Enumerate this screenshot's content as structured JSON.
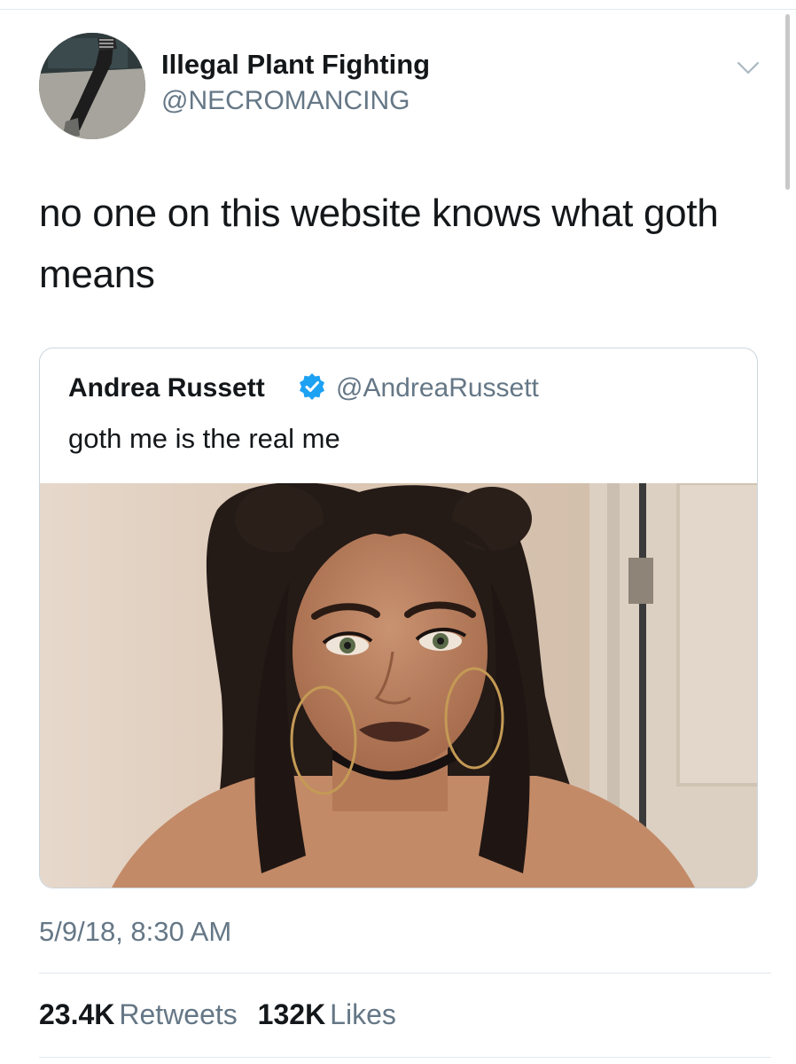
{
  "tweet": {
    "author": {
      "display_name": "Illegal Plant Fighting",
      "handle": "@NECROMANCING",
      "avatar_icon": "profile-photo"
    },
    "menu_icon": "chevron-down-icon",
    "text": "no one on this website knows what goth means",
    "quoted_tweet": {
      "display_name": "Andrea Russett",
      "verified": true,
      "verified_icon": "verified-badge-icon",
      "handle": "@AndreaRussett",
      "text": "goth me is the real me",
      "media": "photo"
    },
    "timestamp": "5/9/18, 8:30 AM",
    "stats": {
      "retweets_count": "23.4K",
      "retweets_label": "Retweets",
      "likes_count": "132K",
      "likes_label": "Likes"
    }
  },
  "colors": {
    "text_primary": "#14171a",
    "text_secondary": "#657786",
    "border": "#ccd6dd",
    "divider": "#e1e8ed",
    "verified_blue": "#1da1f2"
  }
}
